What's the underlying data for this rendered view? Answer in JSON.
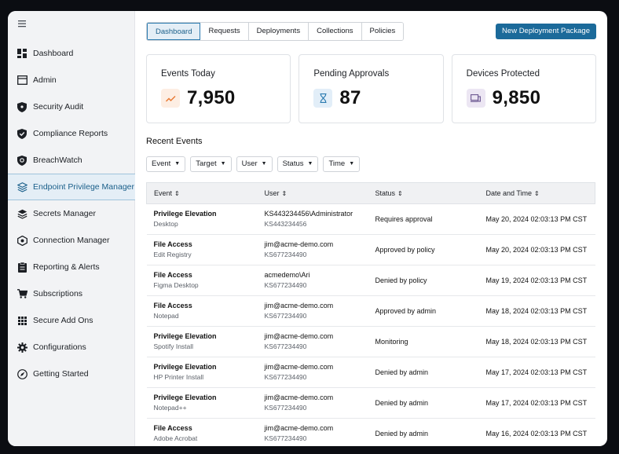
{
  "sidebar": {
    "items": [
      {
        "label": "Dashboard",
        "icon": "dashboard-icon"
      },
      {
        "label": "Admin",
        "icon": "admin-icon"
      },
      {
        "label": "Security Audit",
        "icon": "shield-icon"
      },
      {
        "label": "Compliance Reports",
        "icon": "shield-check-icon"
      },
      {
        "label": "BreachWatch",
        "icon": "breachwatch-icon"
      },
      {
        "label": "Endpoint Privilege Manager",
        "icon": "layers-icon"
      },
      {
        "label": "Secrets Manager",
        "icon": "secrets-icon"
      },
      {
        "label": "Connection Manager",
        "icon": "connection-icon"
      },
      {
        "label": "Reporting & Alerts",
        "icon": "report-icon"
      },
      {
        "label": "Subscriptions",
        "icon": "cart-icon"
      },
      {
        "label": "Secure Add Ons",
        "icon": "grid-icon"
      },
      {
        "label": "Configurations",
        "icon": "gear-icon"
      },
      {
        "label": "Getting Started",
        "icon": "rocket-icon"
      }
    ],
    "active_index": 5
  },
  "tabs": [
    "Dashboard",
    "Requests",
    "Deployments",
    "Collections",
    "Policies"
  ],
  "new_package_label": "New Deployment Package",
  "cards": [
    {
      "title": "Events Today",
      "value": "7,950",
      "icon": "trend-icon"
    },
    {
      "title": "Pending Approvals",
      "value": "87",
      "icon": "hourglass-icon"
    },
    {
      "title": "Devices Protected",
      "value": "9,850",
      "icon": "device-icon"
    }
  ],
  "recent_events_title": "Recent Events",
  "filters": [
    "Event",
    "Target",
    "User",
    "Status",
    "Time"
  ],
  "table": {
    "headers": [
      "Event",
      "User",
      "Status",
      "Date and Time"
    ],
    "rows": [
      {
        "event": "Privilege Elevation",
        "target": "Desktop",
        "user": "KS443234456\\Administrator",
        "device": "KS443234456",
        "status": "Requires approval",
        "time": "May 20, 2024 02:03:13 PM CST"
      },
      {
        "event": "File Access",
        "target": "Edit Registry",
        "user": "jim@acme-demo.com",
        "device": "KS677234490",
        "status": "Approved by policy",
        "time": "May 20, 2024 02:03:13 PM CST"
      },
      {
        "event": "File Access",
        "target": "Figma Desktop",
        "user": "acmedemo\\Ari",
        "device": "KS677234490",
        "status": "Denied by policy",
        "time": "May 19, 2024 02:03:13 PM CST"
      },
      {
        "event": "File Access",
        "target": "Notepad",
        "user": "jim@acme-demo.com",
        "device": "KS677234490",
        "status": "Approved by admin",
        "time": "May 18, 2024 02:03:13 PM CST"
      },
      {
        "event": "Privilege Elevation",
        "target": "Spotify Install",
        "user": "jim@acme-demo.com",
        "device": "KS677234490",
        "status": "Monitoring",
        "time": "May 18, 2024 02:03:13 PM CST"
      },
      {
        "event": "Privilege Elevation",
        "target": "HP Printer Install",
        "user": "jim@acme-demo.com",
        "device": "KS677234490",
        "status": "Denied by admin",
        "time": "May 17, 2024 02:03:13 PM CST"
      },
      {
        "event": "Privilege Elevation",
        "target": "Notepad++",
        "user": "jim@acme-demo.com",
        "device": "KS677234490",
        "status": "Denied by admin",
        "time": "May 17, 2024 02:03:13 PM CST"
      },
      {
        "event": "File Access",
        "target": "Adobe Acrobat",
        "user": "jim@acme-demo.com",
        "device": "KS677234490",
        "status": "Denied by admin",
        "time": "May 16, 2024 02:03:13 PM CST"
      }
    ]
  },
  "colors": {
    "accent": "#1b6a9a",
    "active_bg": "#e4eef6"
  }
}
